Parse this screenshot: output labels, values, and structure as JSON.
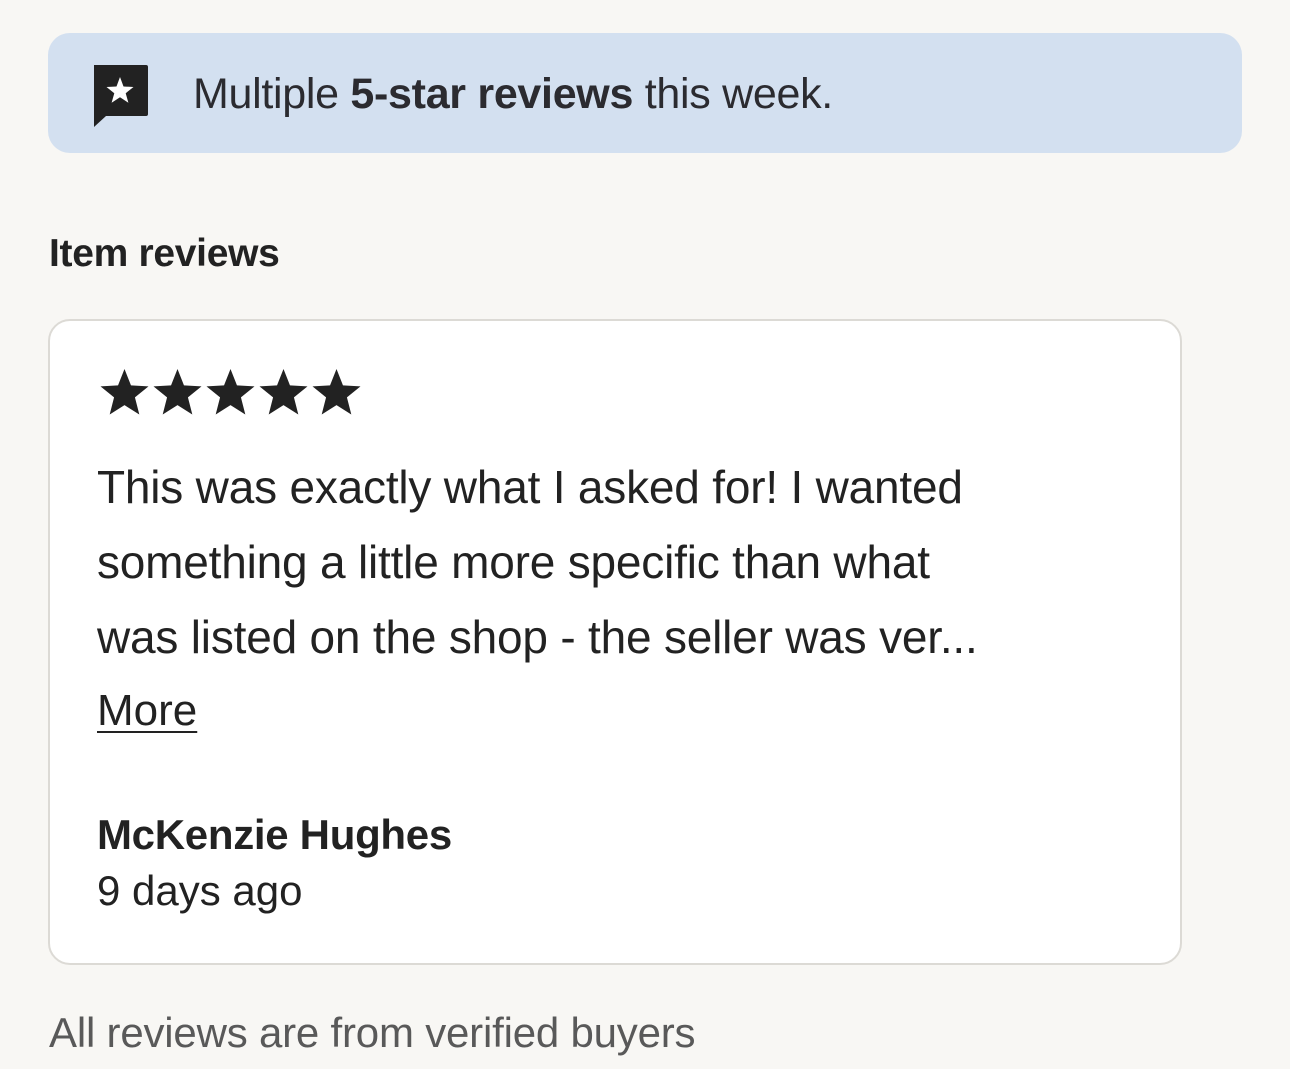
{
  "banner": {
    "icon": "speech-bubble-star-icon",
    "text_before": "Multiple ",
    "text_bold": "5-star reviews",
    "text_after": " this week."
  },
  "reviews_section": {
    "title": "Item reviews"
  },
  "review": {
    "rating": 5,
    "rating_max": 5,
    "star_icon": "star-icon",
    "text_lines": [
      "This was exactly what I asked for! I wanted",
      "something a little more specific than what",
      "was listed on the shop - the seller was ver..."
    ],
    "more_label": "More",
    "reviewer_name": "McKenzie Hughes",
    "date": "9 days ago"
  },
  "footer": {
    "note": "All reviews are from verified buyers"
  },
  "colors": {
    "page_background": "#f8f7f4",
    "banner_background": "#d3e0f0",
    "text_primary": "#222222",
    "text_secondary": "#595959",
    "card_border": "#dcdad5"
  }
}
